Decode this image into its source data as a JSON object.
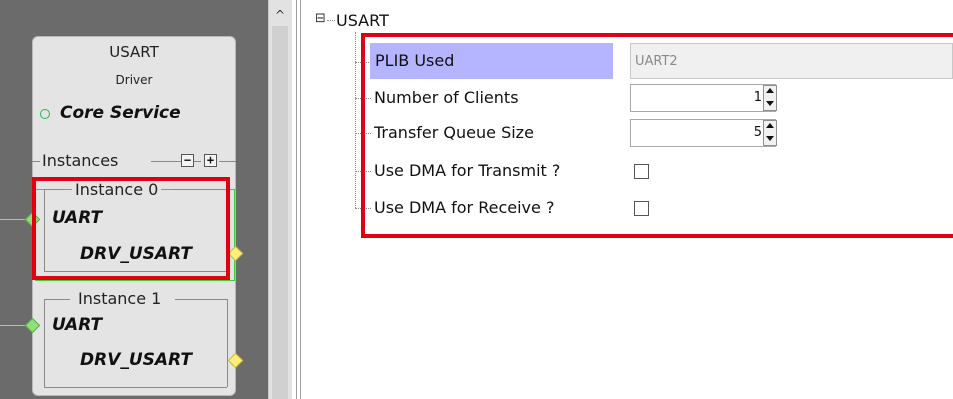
{
  "component": {
    "title": "USART",
    "subtitle": "Driver",
    "dependency": "Core Service",
    "instances_label": "Instances",
    "remove_symbol": "−",
    "add_symbol": "+",
    "instances": [
      {
        "label": "Instance 0",
        "consumer": "UART",
        "provider": "DRV_USART"
      },
      {
        "label": "Instance 1",
        "consumer": "UART",
        "provider": "DRV_USART"
      }
    ]
  },
  "scrollbar": {
    "up_arrow": "^"
  },
  "tree": {
    "expander": "⊟",
    "root_label": "USART",
    "properties": [
      {
        "label": "PLIB Used",
        "value": "UART2",
        "kind": "readonly"
      },
      {
        "label": "Number of Clients",
        "value": "1",
        "kind": "spinner"
      },
      {
        "label": "Transfer Queue Size",
        "value": "5",
        "kind": "spinner"
      },
      {
        "label": "Use DMA for Transmit ?",
        "value": false,
        "kind": "checkbox"
      },
      {
        "label": "Use DMA for Receive ?",
        "value": false,
        "kind": "checkbox"
      }
    ]
  },
  "colors": {
    "highlight_red": "#e0000f",
    "selection": "#b4b4ff",
    "canvas_bg": "#6b6b6b",
    "instance_selected_border": "#38d038"
  }
}
